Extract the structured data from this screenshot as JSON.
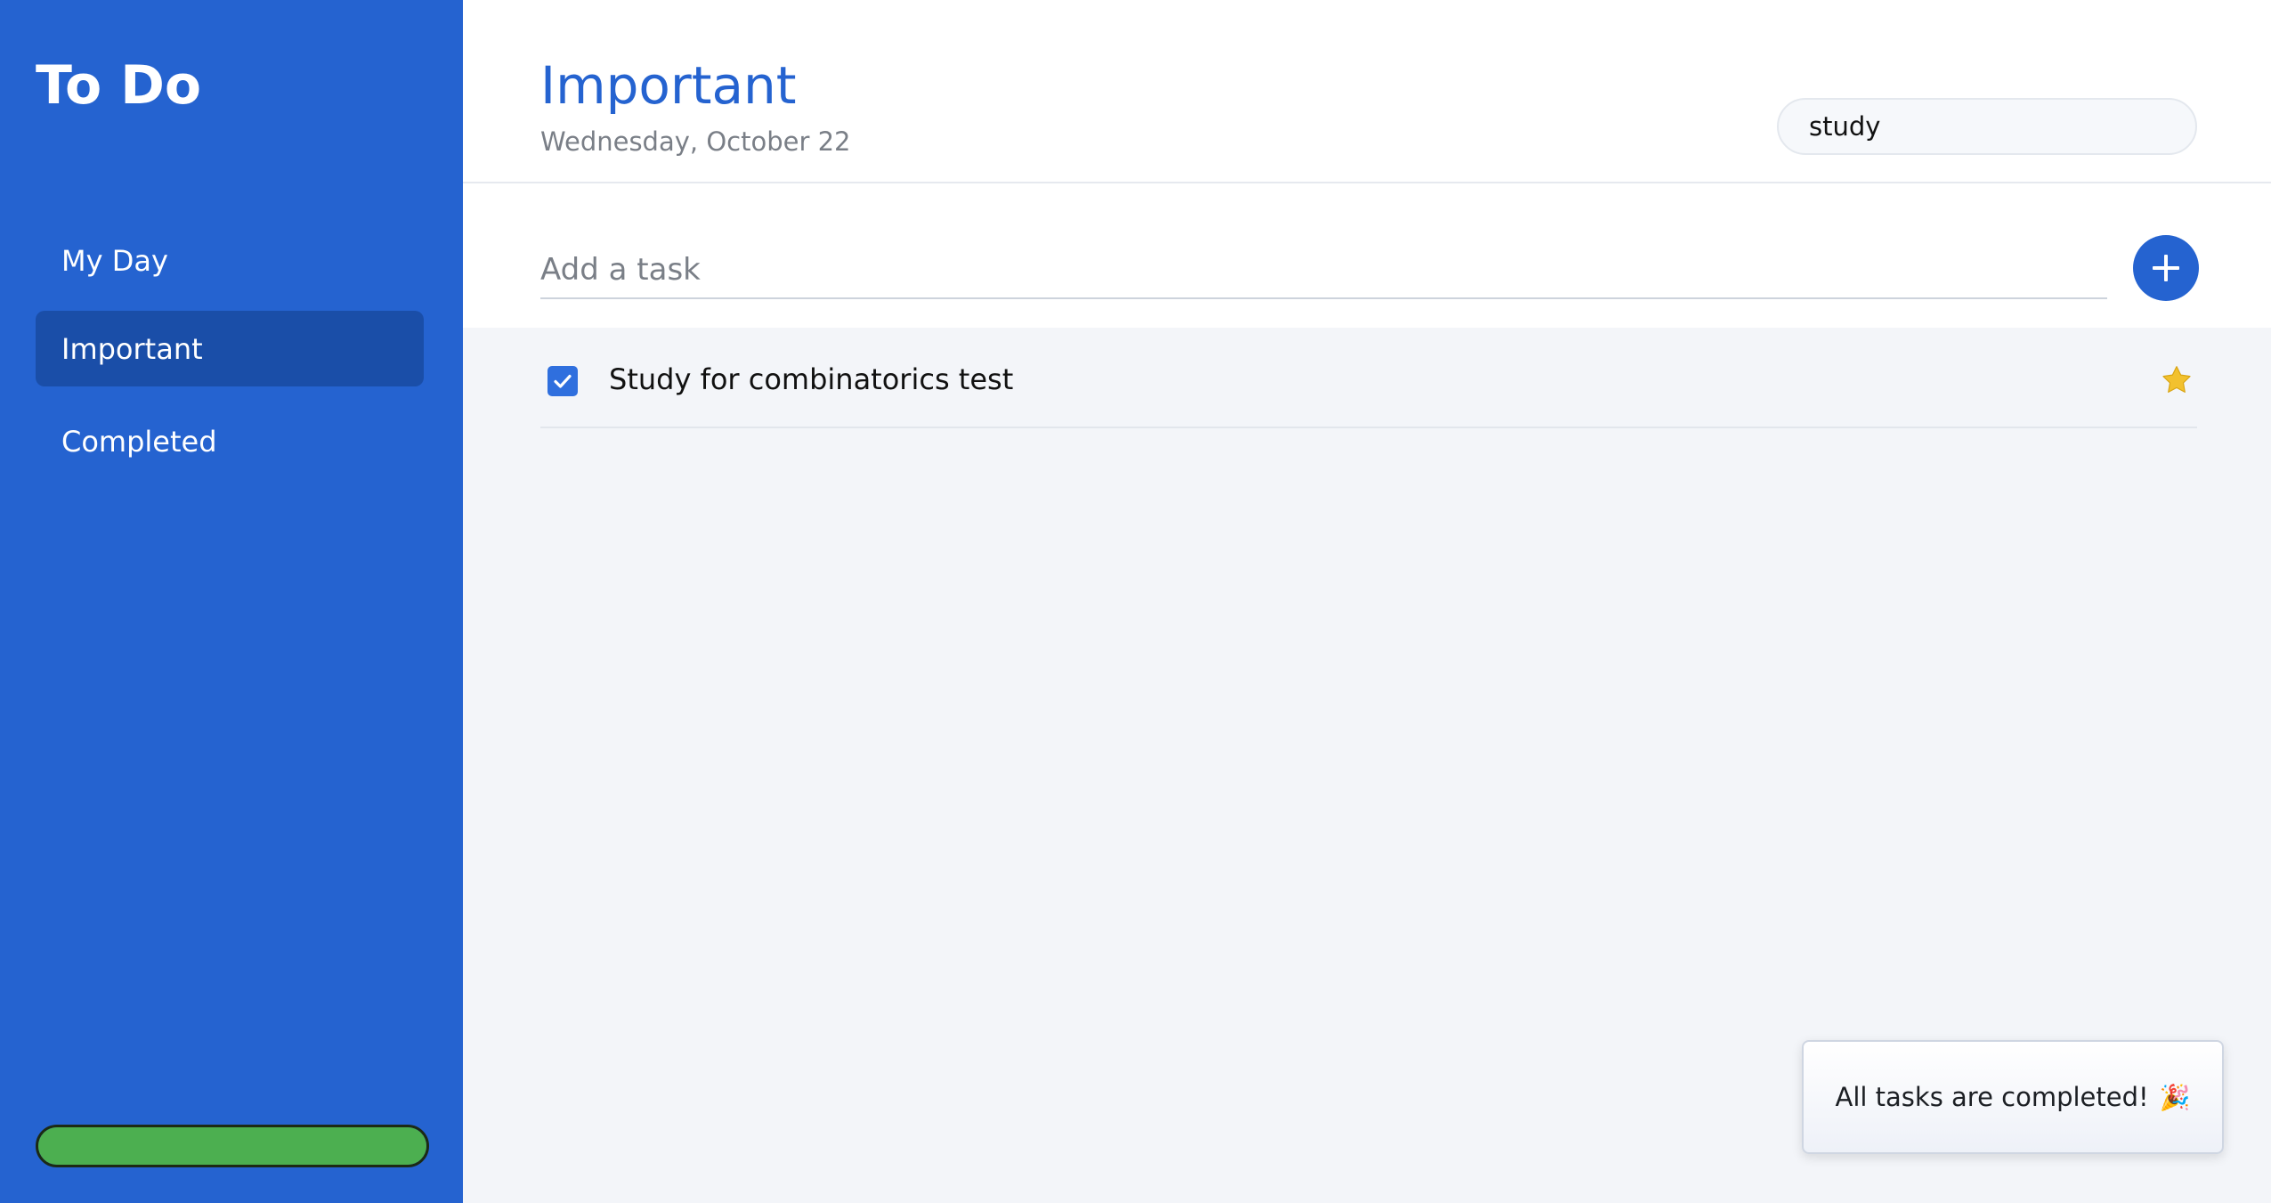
{
  "app": {
    "title": "To Do"
  },
  "sidebar": {
    "items": [
      {
        "label": "My Day",
        "active": false
      },
      {
        "label": "Important",
        "active": true
      },
      {
        "label": "Completed",
        "active": false
      }
    ],
    "progress": {
      "percent": 100,
      "color": "#4caf50"
    }
  },
  "header": {
    "title": "Important",
    "date": "Wednesday, October 22",
    "search": {
      "value": "study"
    }
  },
  "add_task": {
    "placeholder": "Add a task",
    "button_icon": "plus-icon"
  },
  "tasks": [
    {
      "text": "Study for combinatorics test",
      "completed": true,
      "important": true,
      "check_icon": "checkmark-icon",
      "star_icon": "star-icon"
    }
  ],
  "toast": {
    "message": "All tasks are completed!",
    "emoji": "🎉"
  },
  "colors": {
    "sidebar": "#2563d0",
    "sidebar_active": "#1a4ea8",
    "accent": "#2563d0",
    "star": "#f2c12e",
    "progress": "#4caf50"
  }
}
